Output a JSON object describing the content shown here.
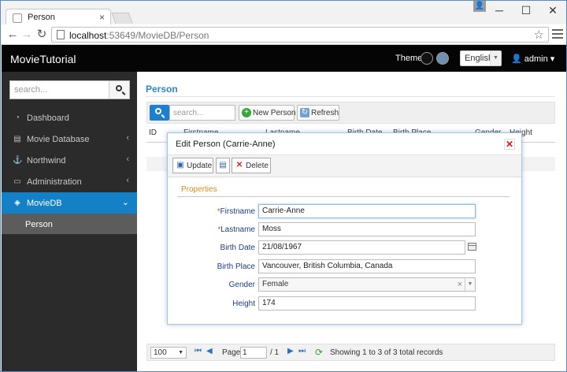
{
  "browser": {
    "tab_title": "Person",
    "tab_close": "×",
    "url_host": "localhost",
    "url_rest": ":53649/MovieDB/Person",
    "window_min": "─",
    "window_max": "☐",
    "window_close": "✕"
  },
  "app": {
    "brand": "MovieTutorial",
    "theme_label": "Theme",
    "language": "English",
    "user": "admin"
  },
  "sidebar": {
    "search_placeholder": "search...",
    "items": [
      {
        "label": "Dashboard",
        "icon": "dashboard-icon"
      },
      {
        "label": "Movie Database",
        "icon": "film-icon"
      },
      {
        "label": "Northwind",
        "icon": "anchor-icon"
      },
      {
        "label": "Administration",
        "icon": "monitor-icon"
      },
      {
        "label": "MovieDB",
        "icon": "layers-icon"
      }
    ],
    "sub_item": "Person"
  },
  "main": {
    "title": "Person",
    "search_placeholder": "search...",
    "new_button": "New Person",
    "refresh_button": "Refresh",
    "columns": [
      "ID",
      "Firstname",
      "Lastname",
      "Birth Date",
      "Birth Place",
      "Gender",
      "Height"
    ]
  },
  "pager": {
    "page_size": "100",
    "page_label": "Page",
    "page_value": "1",
    "page_total": "/ 1",
    "status": "Showing 1 to 3 of 3 total records"
  },
  "dialog": {
    "title": "Edit Person (Carrie-Anne)",
    "update_button": "Update",
    "delete_button": "Delete",
    "section": "Properties",
    "fields": {
      "firstname_label": "Firstname",
      "firstname_value": "Carrie-Anne",
      "lastname_label": "Lastname",
      "lastname_value": "Moss",
      "birthdate_label": "Birth Date",
      "birthdate_value": "21/08/1967",
      "birthplace_label": "Birth Place",
      "birthplace_value": "Vancouver, British Columbia, Canada",
      "gender_label": "Gender",
      "gender_value": "Female",
      "height_label": "Height",
      "height_value": "174"
    },
    "required_mark": "*"
  },
  "colors": {
    "accent": "#1481c7",
    "header_bg": "#050505",
    "sidebar_bg": "#2b2b2b",
    "title_blue": "#2e86c4",
    "section_orange": "#d98a1e"
  }
}
